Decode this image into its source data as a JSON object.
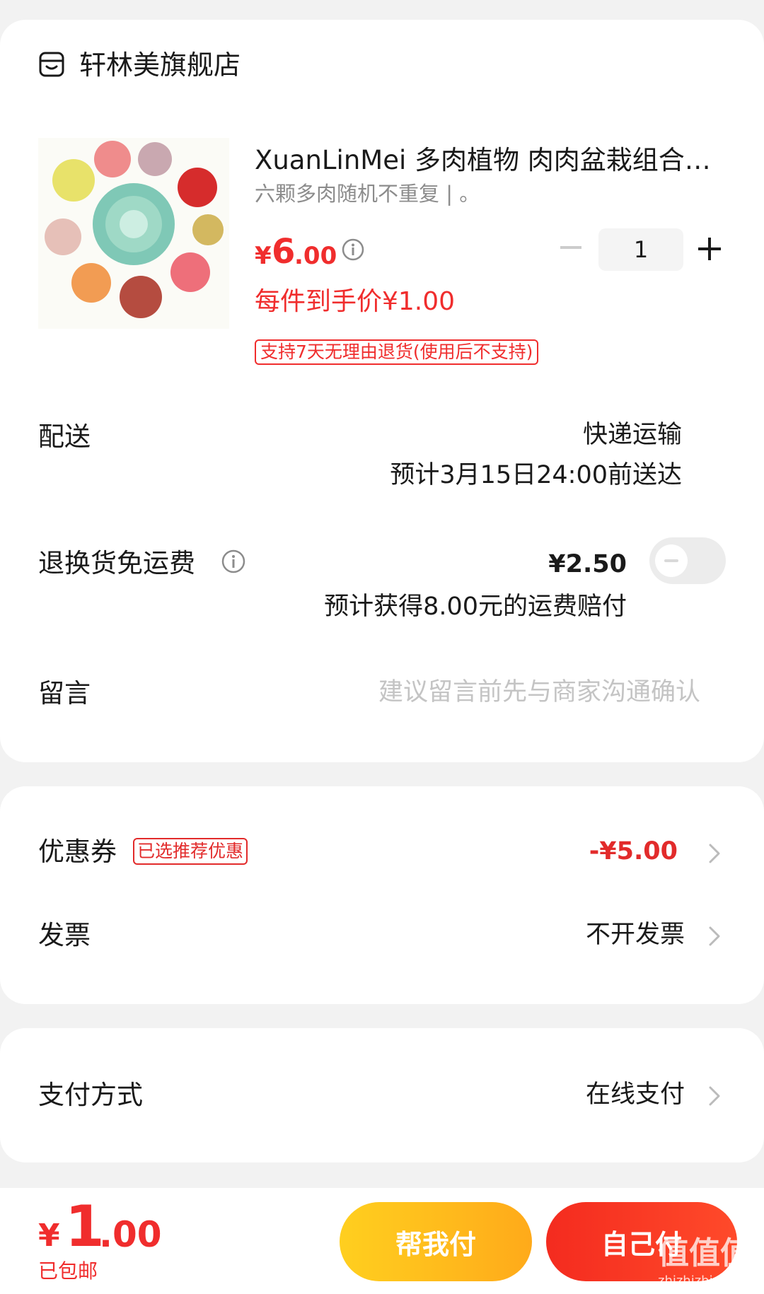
{
  "store": {
    "name": "轩林美旗舰店"
  },
  "product": {
    "title": "XuanLinMei 多肉植物 肉肉盆栽组合…",
    "spec": "六颗多肉随机不重复 | 。",
    "price_symbol": "¥",
    "price_int": "6",
    "price_dec": ".00",
    "quantity": "1",
    "unit_price_note": "每件到手价¥1.00",
    "return_policy": "支持7天无理由退货(使用后不支持)"
  },
  "delivery": {
    "label": "配送",
    "method": "快递运输",
    "eta": "预计3月15日24:00前送达"
  },
  "refund_shipping": {
    "label": "退换货免运费",
    "price": "¥2.50",
    "note": "预计获得8.00元的运费赔付",
    "enabled": false
  },
  "message": {
    "label": "留言",
    "placeholder": "建议留言前先与商家沟通确认"
  },
  "coupon": {
    "label": "优惠券",
    "badge": "已选推荐优惠",
    "value": "-¥5.00"
  },
  "invoice": {
    "label": "发票",
    "value": "不开发票"
  },
  "payment": {
    "label": "支付方式",
    "value": "在线支付"
  },
  "footer": {
    "total_symbol": "¥",
    "total_int": "1",
    "total_dec": ".00",
    "shipping_note": "已包邮",
    "help_pay_label": "帮我付",
    "self_pay_label": "自己付",
    "watermark": "值值值",
    "watermark_url": "zhizhizhi.com"
  },
  "colors": {
    "accent_red": "#f02d2d",
    "help_pay": "#ffcf1f",
    "self_pay": "#f42b1f"
  }
}
